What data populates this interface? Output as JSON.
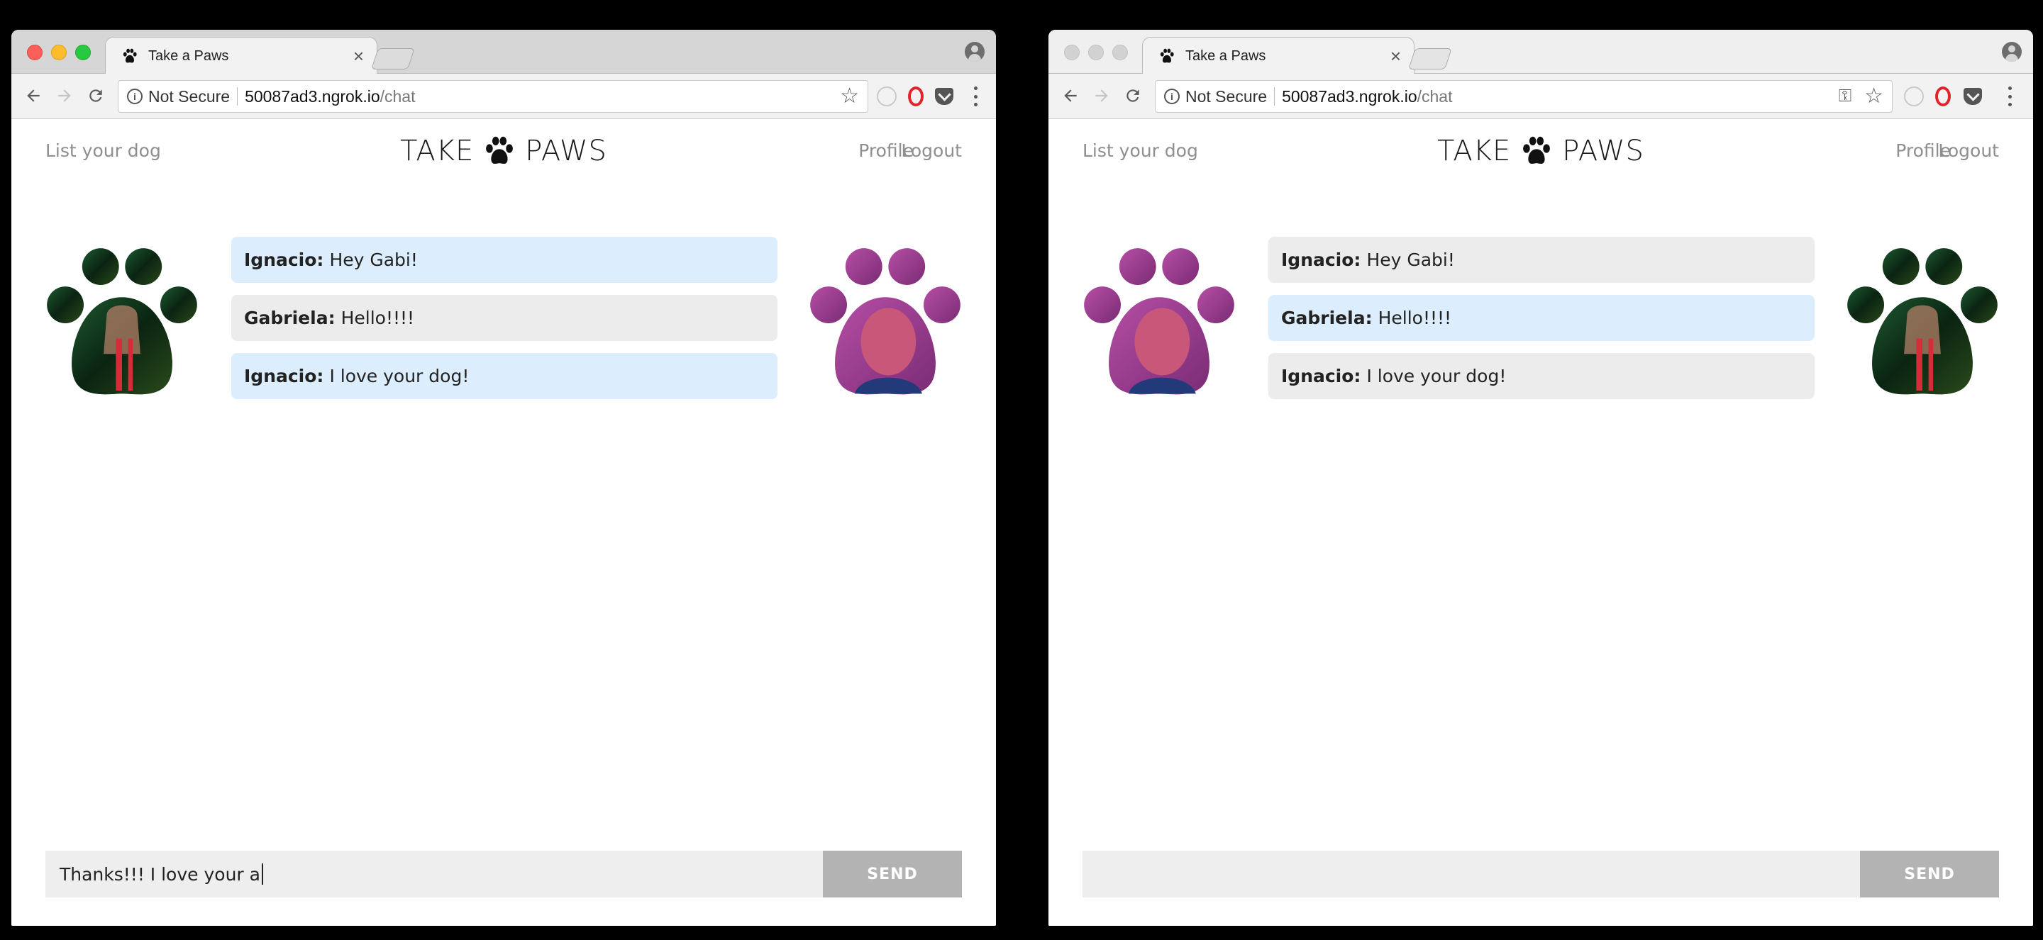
{
  "windows": [
    {
      "tab": {
        "title": "Take a Paws"
      },
      "address": {
        "security_label": "Not Secure",
        "host": "50087ad3.ngrok.io",
        "path": "/chat"
      },
      "nav": {
        "list_dog": "List your dog",
        "brand_left": "TAKE",
        "brand_right": "PAWS",
        "profile": "Profile",
        "logout": "Logout"
      },
      "messages": [
        {
          "sender": "Ignacio:",
          "text": "Hey Gabi!",
          "own": true
        },
        {
          "sender": "Gabriela:",
          "text": "Hello!!!!",
          "own": false
        },
        {
          "sender": "Ignacio:",
          "text": "I love your dog!",
          "own": true
        }
      ],
      "composer": {
        "value": "Thanks!!! I love your a",
        "send_label": "SEND"
      },
      "avatars": {
        "left_tint": "#0f3a1e",
        "right_tint": "#9a3a9a"
      }
    },
    {
      "tab": {
        "title": "Take a Paws"
      },
      "address": {
        "security_label": "Not Secure",
        "host": "50087ad3.ngrok.io",
        "path": "/chat"
      },
      "nav": {
        "list_dog": "List your dog",
        "brand_left": "TAKE",
        "brand_right": "PAWS",
        "profile": "Profile",
        "logout": "Logout"
      },
      "messages": [
        {
          "sender": "Ignacio:",
          "text": "Hey Gabi!",
          "own": false
        },
        {
          "sender": "Gabriela:",
          "text": "Hello!!!!",
          "own": true
        },
        {
          "sender": "Ignacio:",
          "text": "I love your dog!",
          "own": false
        }
      ],
      "composer": {
        "value": "",
        "send_label": "SEND"
      },
      "avatars": {
        "left_tint": "#9a3a9a",
        "right_tint": "#0f3a1e"
      }
    }
  ],
  "colors": {
    "own_bubble": "#dceefd",
    "other_bubble": "#ececec",
    "send_button": "#b3b3b3",
    "opera_red": "#e0242d"
  },
  "icons": [
    "paw-favicon-icon",
    "back-arrow-icon",
    "forward-arrow-icon",
    "reload-icon",
    "info-icon",
    "star-icon",
    "key-icon",
    "opera-icon",
    "pocket-icon",
    "menu-dots-icon",
    "paw-logo-icon"
  ]
}
